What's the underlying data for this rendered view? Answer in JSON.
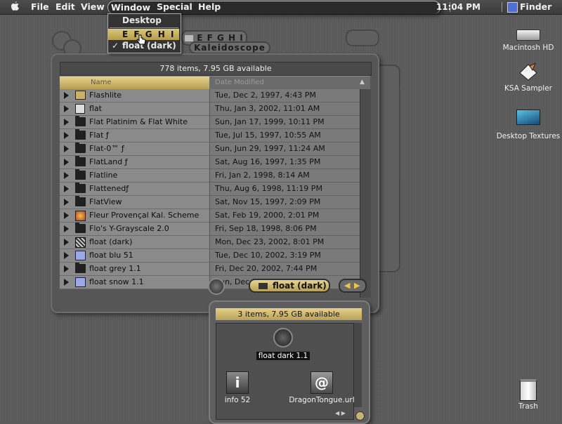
{
  "menubar": {
    "apple": "",
    "items": [
      "File",
      "Edit",
      "View",
      "Window",
      "Special",
      "Help"
    ],
    "clock": "11:04 PM",
    "app_name": "Finder"
  },
  "window_menu": {
    "items": [
      {
        "label": "Desktop",
        "checked": false,
        "highlighted": false
      },
      {
        "label": "E F G H I",
        "checked": false,
        "highlighted": true
      },
      {
        "label": "float (dark)",
        "checked": true,
        "highlighted": false
      }
    ],
    "check_glyph": "✓"
  },
  "background_windows": {
    "tab1": "E F G H I",
    "tab2": "Kaleidoscope"
  },
  "list_window": {
    "status": "778 items, 7.95 GB available",
    "col_name": "Name",
    "col_date": "Date Modified",
    "sort_glyph": "▲",
    "rows": [
      {
        "name": "Flashlite",
        "date": "Tue, Dec 2, 1997, 4:43 PM",
        "icon": "app"
      },
      {
        "name": "flat",
        "date": "Thu, Jan 3, 2002, 11:01 AM",
        "icon": "doc"
      },
      {
        "name": "Flat Platinim & Flat White",
        "date": "Sun, Jan 17, 1999, 10:11 PM",
        "icon": "folder"
      },
      {
        "name": "Flat ƒ",
        "date": "Tue, Jul 15, 1997, 10:55 AM",
        "icon": "folder"
      },
      {
        "name": "Flat-0™ ƒ",
        "date": "Sun, Jun 29, 1997, 11:24 AM",
        "icon": "folder"
      },
      {
        "name": "FlatLand ƒ",
        "date": "Sat, Aug 16, 1997, 1:35 PM",
        "icon": "folder"
      },
      {
        "name": "Flatline",
        "date": "Fri, Jan 2, 1998, 8:14 AM",
        "icon": "folder"
      },
      {
        "name": "Flattenedƒ",
        "date": "Thu, Aug 6, 1998, 11:19 PM",
        "icon": "folder"
      },
      {
        "name": "FlatView",
        "date": "Sat, Nov 15, 1997, 2:09 PM",
        "icon": "folder"
      },
      {
        "name": "Fleur Provençal Kal. Scheme",
        "date": "Sat, Feb 19, 2000, 2:01 PM",
        "icon": "fleur"
      },
      {
        "name": "Flo's Y-Grayscale 2.0",
        "date": "Fri, Sep 18, 1998, 8:06 PM",
        "icon": "folder"
      },
      {
        "name": "float (dark)",
        "date": "Mon, Dec 23, 2002, 8:01 PM",
        "icon": "pattern"
      },
      {
        "name": "float blu 51",
        "date": "Tue, Dec 10, 2002, 3:19 PM",
        "icon": "blue"
      },
      {
        "name": "float grey 1.1",
        "date": "Fri, Dec 20, 2002, 7:44 PM",
        "icon": "folder"
      },
      {
        "name": "float snow 1.1",
        "date": "Sun, Dec 15, 2002",
        "icon": "blue"
      }
    ],
    "footer_label": "float (dark)"
  },
  "small_window": {
    "status": "3 items, 7.95 GB available",
    "icons": [
      {
        "label": "float dark 1.1",
        "glyph": "",
        "selected": true
      },
      {
        "label": "info 52",
        "glyph": "i",
        "selected": false
      },
      {
        "label": "DragonTongue.url",
        "glyph": "@",
        "selected": false
      }
    ]
  },
  "desktop_icons": [
    {
      "label": "Macintosh HD"
    },
    {
      "label": "KSA Sampler"
    },
    {
      "label": "Desktop Textures"
    },
    {
      "label": "Trash"
    }
  ],
  "colors": {
    "accent_gold": "#d6c27a",
    "desktop": "#5b5b5b"
  }
}
